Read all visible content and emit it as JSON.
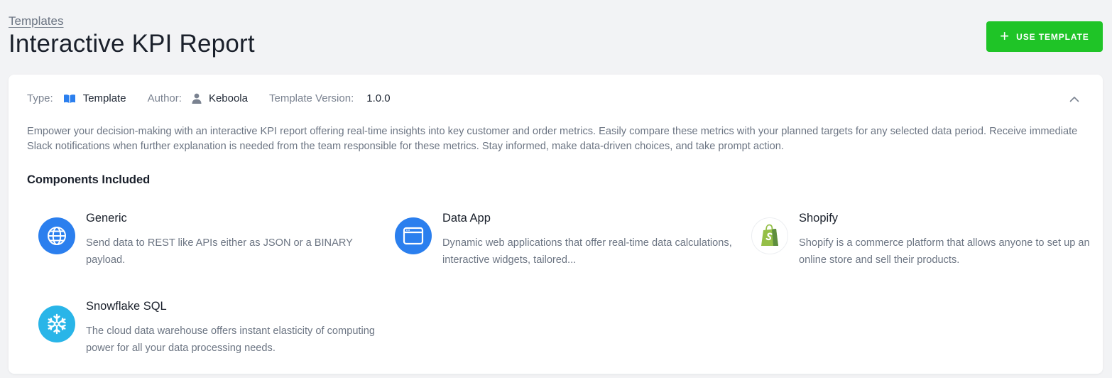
{
  "breadcrumb": "Templates",
  "page_title": "Interactive KPI Report",
  "use_template_button": {
    "icon": "plus-icon",
    "label": "USE TEMPLATE"
  },
  "meta": {
    "type_label": "Type:",
    "type_value": "Template",
    "type_icon": "book-icon",
    "author_label": "Author:",
    "author_value": "Keboola",
    "author_icon": "user-icon",
    "version_label": "Template Version:",
    "version_value": "1.0.0"
  },
  "description": "Empower your decision-making with an interactive KPI report offering real-time insights into key customer and order metrics. Easily compare these metrics with your planned targets for any selected data period. Receive immediate Slack notifications when further explanation is needed from the team responsible for these metrics. Stay informed, make data-driven choices, and take prompt action.",
  "components_heading": "Components Included",
  "components": [
    {
      "name": "Generic",
      "description": "Send data to REST like APIs either as JSON or a BINARY payload.",
      "icon": "globe-icon"
    },
    {
      "name": "Data App",
      "description": "Dynamic web applications that offer real-time data calculations, interactive widgets, tailored...",
      "icon": "browser-window-icon"
    },
    {
      "name": "Shopify",
      "description": "Shopify is a commerce platform that allows anyone to set up an online store and sell their products.",
      "icon": "shopify-bag-icon"
    },
    {
      "name": "Snowflake SQL",
      "description": "The cloud data warehouse offers instant elasticity of computing power for all your data processing needs.",
      "icon": "snowflake-icon"
    }
  ],
  "colors": {
    "accent_green": "#1fc427",
    "icon_blue": "#2b7fee",
    "snowflake_blue": "#29b5e8",
    "shopify_green": "#95bf47"
  }
}
